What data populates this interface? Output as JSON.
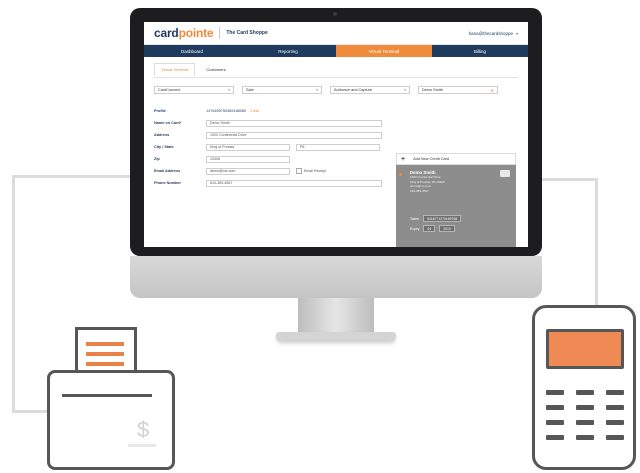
{
  "app": {
    "logo_part1": "card",
    "logo_part2": "pointe",
    "merchant": "The Card Shoppe",
    "user_email": "hana@thecardshoppe",
    "caret": "▾"
  },
  "nav": [
    {
      "label": "Dashboard",
      "active": false
    },
    {
      "label": "Reporting",
      "active": false
    },
    {
      "label": "Virtual Terminal",
      "active": true
    },
    {
      "label": "Billing",
      "active": false
    }
  ],
  "tabs": [
    {
      "label": "Virtual Terminal",
      "active": true
    },
    {
      "label": "Customers",
      "active": false
    }
  ],
  "selects": {
    "merchant": "CardConnect",
    "type": "Sale",
    "mode": "Authorize and Capture",
    "customer": "Demo Smith"
  },
  "form": {
    "profile_label": "Profile",
    "profile_value": "1476495750489168080",
    "profile_clear": "Clear",
    "name_label": "Name on Card*",
    "name_value": "Demo Smith",
    "address_label": "Address",
    "address_value": "1000 Continental Drive",
    "citystate_label": "City / State",
    "city_value": "King of Prussia",
    "state_value": "PA",
    "zip_label": "Zip",
    "zip_value": "19406",
    "email_label": "Email Address",
    "email_value": "demo@me.com",
    "email_receipt": "Email Receipt",
    "phone_label": "Phone Number",
    "phone_value": "610-389-4567"
  },
  "card_panel": {
    "add_label": "Add New Credit Card",
    "plus": "+",
    "card_name": "Demo Smith",
    "card_lines": [
      "1000 Continental Drive",
      "King of Prussia, PA 19406",
      "demo@me.com",
      "610-389-4567"
    ],
    "token_label": "Token",
    "token_value": "9418771270169768",
    "expiry_label": "Expiry",
    "expiry_month": "04",
    "expiry_year": "2019"
  },
  "colors": {
    "brand_navy": "#1f3a5f",
    "brand_orange": "#f08a3c",
    "icon_gray": "#575757",
    "terminal_screen": "#ef8a55"
  },
  "icons": {
    "dollar": "$"
  }
}
